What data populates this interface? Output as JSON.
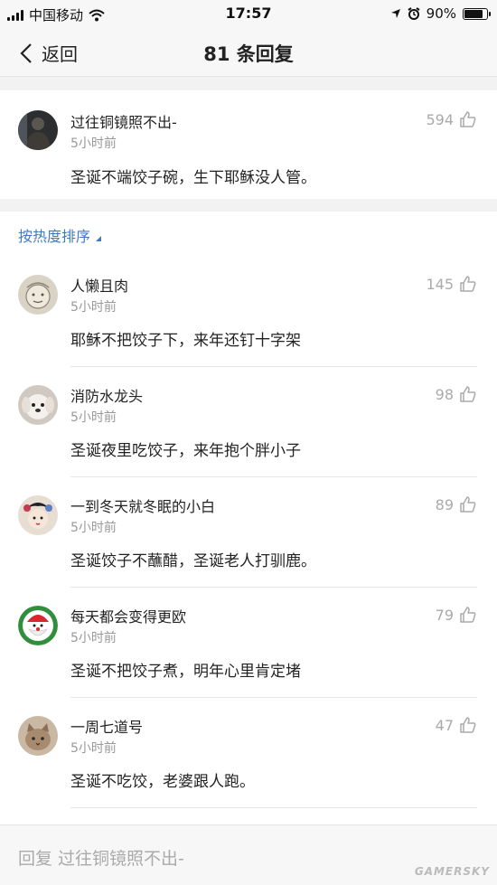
{
  "status_bar": {
    "carrier": "中国移动",
    "time": "17:57",
    "battery": "90%",
    "battery_level": 0.9
  },
  "navbar": {
    "back_label": "返回",
    "title": "81 条回复"
  },
  "top_comment": {
    "username": "过往铜镜照不出-",
    "time": "5小时前",
    "text": "圣诞不端饺子碗，生下耶稣没人管。",
    "likes": "594"
  },
  "sort": {
    "label": "按热度排序"
  },
  "comments": [
    {
      "username": "人懒且肉",
      "time": "5小时前",
      "text": "耶稣不把饺子下，来年还钉十字架",
      "likes": "145"
    },
    {
      "username": "消防水龙头",
      "time": "5小时前",
      "text": "圣诞夜里吃饺子，来年抱个胖小子",
      "likes": "98"
    },
    {
      "username": "一到冬天就冬眠的小白",
      "time": "5小时前",
      "text": "圣诞饺子不蘸醋，圣诞老人打驯鹿。",
      "likes": "89"
    },
    {
      "username": "每天都会变得更欧",
      "time": "5小时前",
      "text": "圣诞不把饺子煮，明年心里肯定堵",
      "likes": "79"
    },
    {
      "username": "一周七道号",
      "time": "5小时前",
      "text": "圣诞不吃饺，老婆跟人跑。",
      "likes": "47"
    }
  ],
  "reply_bar": {
    "placeholder": "回复 过往铜镜照不出-",
    "watermark": "GAMERSKY"
  },
  "colors": {
    "link_blue": "#3e7bc4",
    "secondary_text": "#999999",
    "background": "#f2f2f2"
  }
}
